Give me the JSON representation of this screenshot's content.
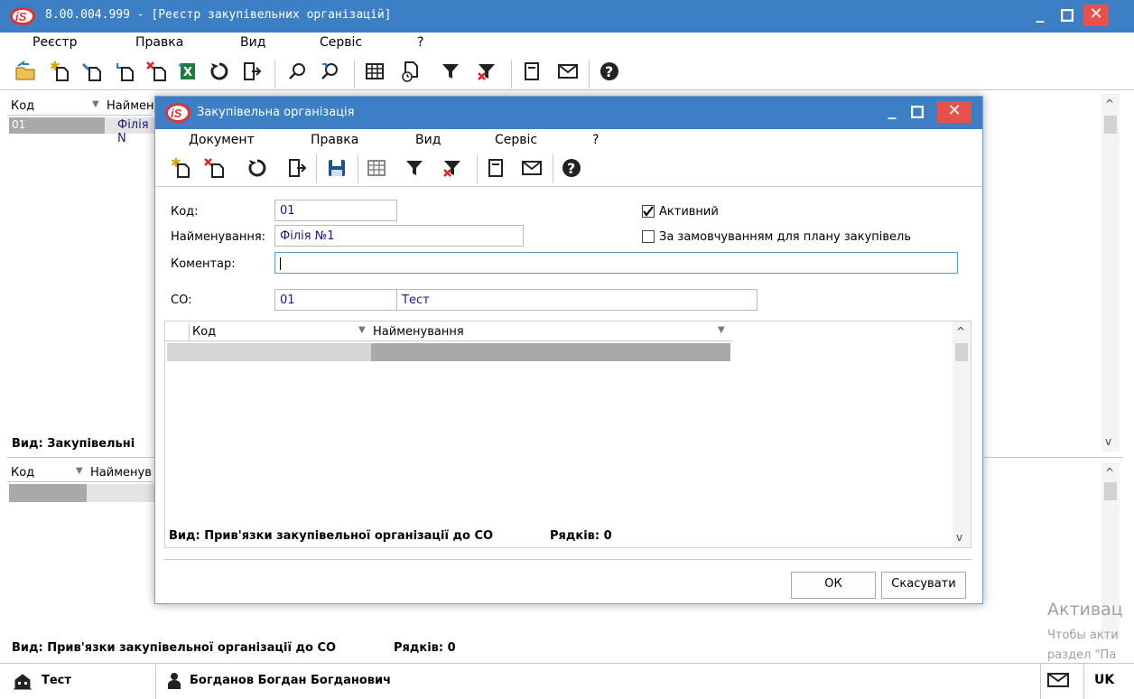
{
  "main": {
    "title": "8.00.004.999 - [Реєстр закупівельних організацій]",
    "menu": [
      "Реєстр",
      "Правка",
      "Вид",
      "Сервіс",
      "?"
    ],
    "grid1": {
      "headers": [
        "Код",
        "Наймен"
      ],
      "row": {
        "code": "01",
        "name": "Філія N"
      }
    },
    "grid1_view_label": "Вид: Закупівельні",
    "grid2": {
      "headers": [
        "Код",
        "Найменув"
      ]
    },
    "grid2_view_label": "Вид: Прив'язки закупівельної організації до СО",
    "grid2_rows_label": "Рядків: 0"
  },
  "status": {
    "org": "Тест",
    "user": "Богданов Богдан Богданович",
    "lang": "UK"
  },
  "watermark": {
    "line1": "Активац",
    "line2": "Чтобы акти",
    "line3": "раздел \"Па"
  },
  "dialog": {
    "title": "Закупівельна організація",
    "menu": [
      "Документ",
      "Правка",
      "Вид",
      "Сервіс",
      "?"
    ],
    "code_label": "Код:",
    "code_value": "01",
    "name_label": "Найменування:",
    "name_value": "Філія №1",
    "comment_label": "Коментар:",
    "comment_value": "",
    "co_label": "СО:",
    "co_code": "01",
    "co_name": "Тест",
    "active_label": "Активний",
    "active_checked": true,
    "default_label": "За замовчуванням для плану закупівель",
    "default_checked": false,
    "grid_headers": [
      "Код",
      "Найменування"
    ],
    "grid_view_label": "Вид: Прив'язки закупівельної організації до СО",
    "grid_rows_label": "Рядків: 0",
    "ok_label": "ОК",
    "cancel_label": "Скасувати"
  },
  "colors": {
    "titlebar": "#3c7fc4",
    "close": "#e8504a",
    "row_selected": "#a9a9a9",
    "link_text": "#1a1a8c"
  }
}
